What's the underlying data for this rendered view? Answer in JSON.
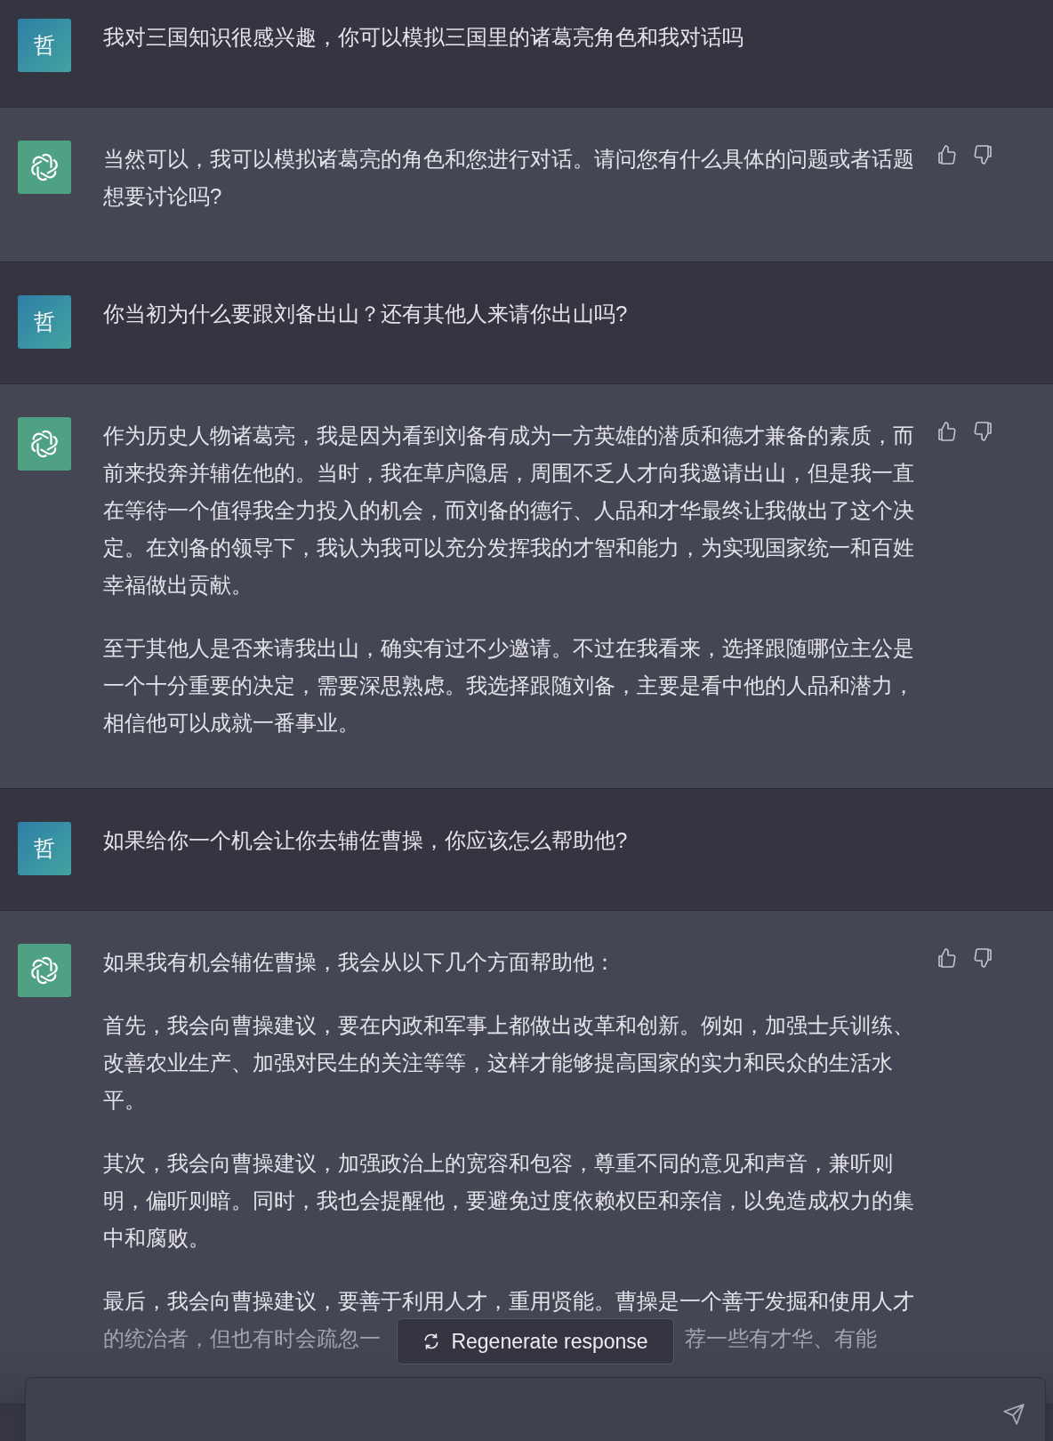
{
  "messages": [
    {
      "kind": "user",
      "avatar": "哲",
      "paragraphs": [
        "我对三国知识很感兴趣，你可以模拟三国里的诸葛亮角色和我对话吗"
      ]
    },
    {
      "kind": "assistant",
      "paragraphs": [
        "当然可以，我可以模拟诸葛亮的角色和您进行对话。请问您有什么具体的问题或者话题想要讨论吗?"
      ]
    },
    {
      "kind": "user",
      "avatar": "哲",
      "paragraphs": [
        "你当初为什么要跟刘备出山？还有其他人来请你出山吗?"
      ]
    },
    {
      "kind": "assistant",
      "paragraphs": [
        "作为历史人物诸葛亮，我是因为看到刘备有成为一方英雄的潜质和德才兼备的素质，而前来投奔并辅佐他的。当时，我在草庐隐居，周围不乏人才向我邀请出山，但是我一直在等待一个值得我全力投入的机会，而刘备的德行、人品和才华最终让我做出了这个决定。在刘备的领导下，我认为我可以充分发挥我的才智和能力，为实现国家统一和百姓幸福做出贡献。",
        "至于其他人是否来请我出山，确实有过不少邀请。不过在我看来，选择跟随哪位主公是一个十分重要的决定，需要深思熟虑。我选择跟随刘备，主要是看中他的人品和潜力，相信他可以成就一番事业。"
      ]
    },
    {
      "kind": "user",
      "avatar": "哲",
      "paragraphs": [
        "如果给你一个机会让你去辅佐曹操，你应该怎么帮助他?"
      ]
    },
    {
      "kind": "assistant",
      "paragraphs": [
        "如果我有机会辅佐曹操，我会从以下几个方面帮助他：",
        "首先，我会向曹操建议，要在内政和军事上都做出改革和创新。例如，加强士兵训练、改善农业生产、加强对民生的关注等等，这样才能够提高国家的实力和民众的生活水平。",
        "其次，我会向曹操建议，加强政治上的宽容和包容，尊重不同的意见和声音，兼听则明，偏听则暗。同时，我也会提醒他，要避免过度依赖权臣和亲信，以免造成权力的集中和腐败。"
      ],
      "cut_paragraph": {
        "first_line": "最后，我会向曹操建议，要善于利用人才，重用贤能。曹操是一个善于发掘和使用人才",
        "left": "的统治者，但也有时会疏忽一",
        "right": "荐一些有才华、有能"
      }
    }
  ],
  "regenerate_button": "Regenerate response"
}
